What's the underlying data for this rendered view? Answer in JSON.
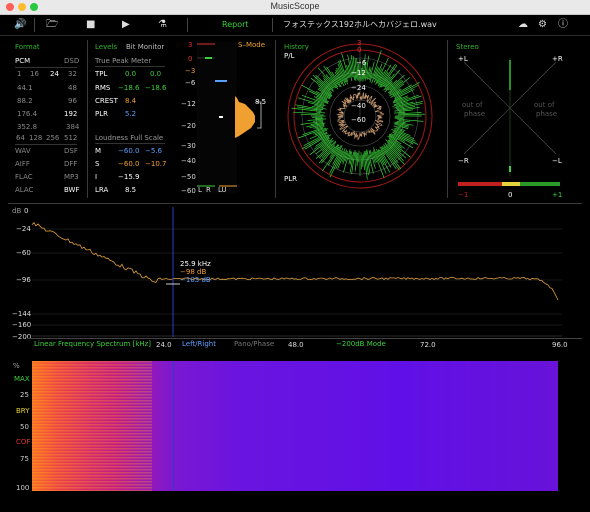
{
  "window": {
    "title": "MusicScope"
  },
  "toolbar": {
    "report": "Report",
    "filename": "フォステックス192ホルヘカバジェロ.wav"
  },
  "format": {
    "header": "Format",
    "pcm": "PCM",
    "dsd": "DSD",
    "rows": [
      [
        "1",
        "16",
        "24",
        "32"
      ]
    ],
    "rates": [
      [
        "44.1",
        "48"
      ],
      [
        "88.2",
        "96"
      ],
      [
        "176.4",
        "192"
      ],
      [
        "352.8",
        "384"
      ]
    ],
    "bits": [
      "64",
      "128",
      "256",
      "512"
    ],
    "types": [
      [
        "WAV",
        "DSF"
      ],
      [
        "AIFF",
        "DFF"
      ],
      [
        "FLAC",
        "MP3"
      ],
      [
        "ALAC",
        "BWF"
      ]
    ]
  },
  "levels": {
    "header": "Levels",
    "bit_monitor": "Bit Monitor",
    "tpm_header": "True Peak Meter",
    "tpm_rows": [
      [
        "TPL",
        "0.0",
        "0.0"
      ],
      [
        "RMS",
        "−18.6",
        "−18.6"
      ],
      [
        "CREST",
        "8.4",
        ""
      ],
      [
        "PLR",
        "5.2",
        ""
      ]
    ],
    "loud_header": "Loudness Full Scale",
    "loud_rows": [
      [
        "M",
        "−60.0",
        "−5.6"
      ],
      [
        "S",
        "−60.0",
        "−10.7"
      ],
      [
        "I",
        "−15.9",
        ""
      ],
      [
        "LRA",
        "8.5",
        ""
      ]
    ]
  },
  "meter": {
    "ticks": [
      "3",
      "0",
      "−3",
      "−6",
      "−12",
      "−20",
      "−30",
      "−40",
      "−50",
      "−60"
    ],
    "smode": "S–Mode",
    "value": "8.5",
    "foot": [
      "L",
      "R",
      "LU"
    ]
  },
  "history": {
    "header": "History",
    "pl": "P/L",
    "plr": "PLR",
    "rings": [
      "−6",
      "−12",
      "−24",
      "−40",
      "−60"
    ],
    "top": [
      "3",
      "0"
    ]
  },
  "stereo": {
    "header": "Stereo",
    "pl": "+L",
    "pr": "+R",
    "ml": "−R",
    "mr": "−L",
    "oop": [
      "out of",
      "phase"
    ],
    "scale": [
      "−1",
      "0",
      "+1"
    ]
  },
  "spectrum": {
    "unit": "dB",
    "yticks": [
      "0",
      "−24",
      "−60",
      "−96",
      "−144",
      "−160",
      "−200"
    ],
    "cursor": {
      "freq": "25.9 kHz",
      "v1": "−98 dB",
      "v2": "−103 dB"
    },
    "bar": {
      "title": "Linear Frequency Spectrum [kHz]",
      "x1": "24.0",
      "lr": "Left/Right",
      "pano": "Pano/Phase",
      "x2": "48.0",
      "mode": "−200dB Mode",
      "x3": "72.0",
      "x4": "96.0"
    }
  },
  "spectrogram": {
    "ylabels": [
      "%",
      "MAX",
      "25",
      "BRY",
      "50",
      "COF",
      "75",
      "100"
    ]
  },
  "colors": {
    "accent_green": "#3ad13a",
    "orange": "#f0a030",
    "blue": "#5aa0ff",
    "red": "#e03030"
  }
}
